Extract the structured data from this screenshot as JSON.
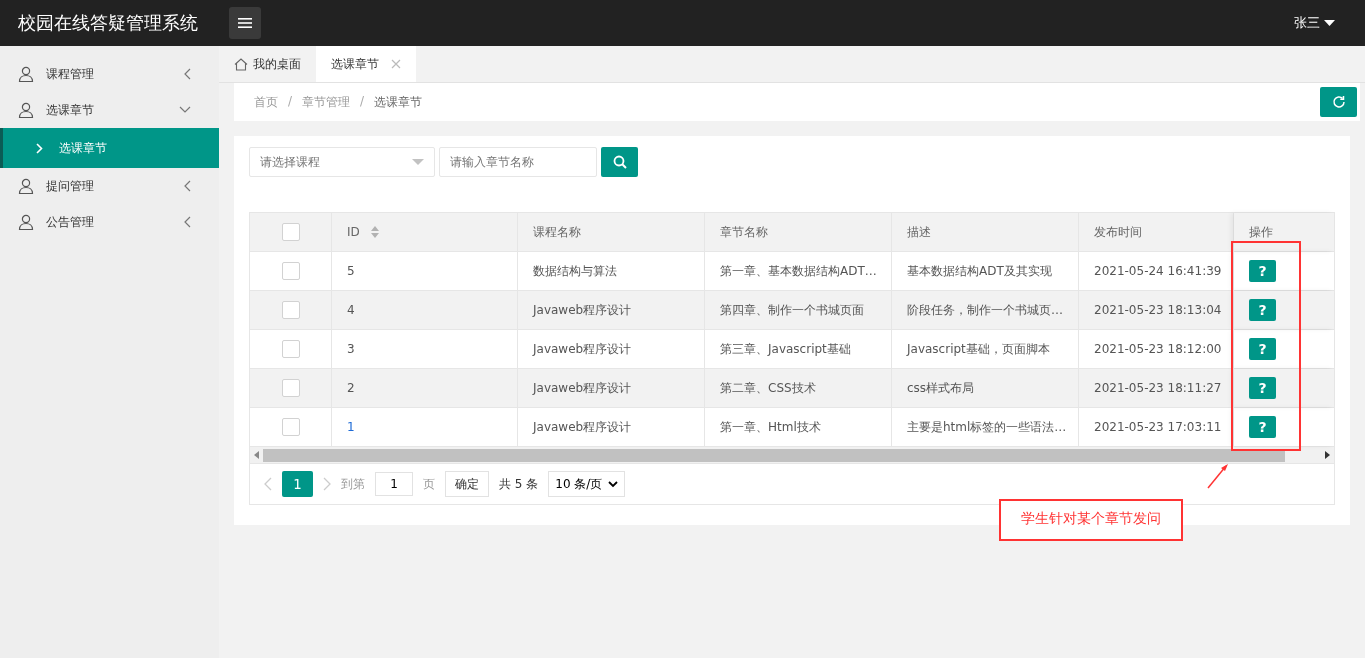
{
  "header": {
    "title": "校园在线答疑管理系统",
    "user": "张三"
  },
  "sidebar": {
    "items": [
      {
        "label": "课程管理",
        "expanded": false
      },
      {
        "label": "选课章节",
        "expanded": true,
        "children": [
          {
            "label": "选课章节",
            "selected": true
          }
        ]
      },
      {
        "label": "提问管理",
        "expanded": false
      },
      {
        "label": "公告管理",
        "expanded": false
      }
    ]
  },
  "tabs": [
    {
      "label": "我的桌面",
      "kind": "home",
      "selected": false
    },
    {
      "label": "选课章节",
      "kind": "closable",
      "selected": true
    }
  ],
  "breadcrumb": {
    "separator": "/",
    "items": [
      "首页",
      "章节管理",
      "选课章节"
    ]
  },
  "filters": {
    "course": {
      "placeholder": "请选择课程"
    },
    "chapter": {
      "placeholder": "请输入章节名称"
    }
  },
  "table": {
    "select_all_checked": false,
    "columns": [
      {
        "label": "ID",
        "sortable": true
      },
      {
        "label": "课程名称"
      },
      {
        "label": "章节名称"
      },
      {
        "label": "描述"
      },
      {
        "label": "发布时间"
      },
      {
        "label": "操作"
      }
    ],
    "rows": [
      {
        "checked": false,
        "hovered": false,
        "cells": [
          "5",
          "数据结构与算法",
          "第一章、基本数据结构ADT…",
          "基本数据结构ADT及其实现",
          "2021-05-24 16:41:39"
        ],
        "action": "?"
      },
      {
        "checked": false,
        "hovered": false,
        "cells": [
          "4",
          "Javaweb程序设计",
          "第四章、制作一个书城页面",
          "阶段任务，制作一个书城页…",
          "2021-05-23 18:13:04"
        ],
        "action": "?"
      },
      {
        "checked": false,
        "hovered": false,
        "cells": [
          "3",
          "Javaweb程序设计",
          "第三章、Javascript基础",
          "Javascript基础，页面脚本",
          "2021-05-23 18:12:00"
        ],
        "action": "?"
      },
      {
        "checked": false,
        "hovered": false,
        "cells": [
          "2",
          "Javaweb程序设计",
          "第二章、CSS技术",
          "css样式布局",
          "2021-05-23 18:11:27"
        ],
        "action": "?"
      },
      {
        "checked": false,
        "hovered": true,
        "cells": [
          "1",
          "Javaweb程序设计",
          "第一章、Html技术",
          "主要是html标签的一些语法…",
          "2021-05-23 17:03:11"
        ],
        "action": "?"
      }
    ]
  },
  "pagination": {
    "page": "1",
    "goto_label": "到第",
    "goto_value": "1",
    "page_label": "页",
    "confirm": "确定",
    "total": "共 5 条",
    "per_page": "10 条/页"
  },
  "annotation": {
    "text": "学生针对某个章节发问"
  }
}
